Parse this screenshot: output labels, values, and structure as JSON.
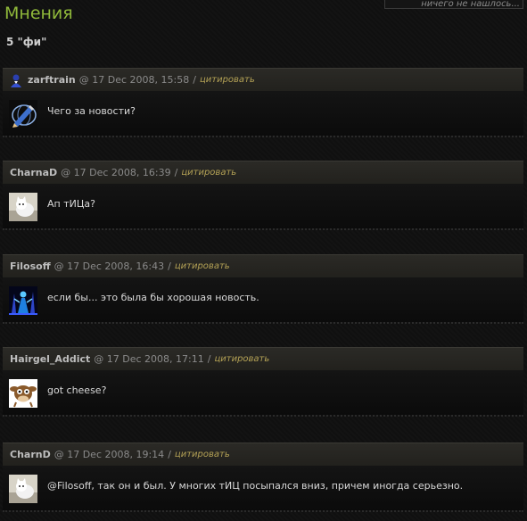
{
  "search": {
    "text": "ничего не нашлось..."
  },
  "page_title": "Мнения",
  "topic_line": "5 \"фи\"",
  "comments": [
    {
      "author": "zarftrain",
      "date": "@ 17 Dec 2008, 15:58",
      "sep": "/",
      "quote": "цитировать",
      "text": "Чего за новости?",
      "avatar_icon": "pencil-globe-icon",
      "header_icon": "user-icon"
    },
    {
      "author": "CharnaD",
      "date": "@ 17 Dec 2008, 16:39",
      "sep": "/",
      "quote": "цитировать",
      "text": "Ап тИЦа?",
      "avatar_icon": "white-cat-icon"
    },
    {
      "author": "Filosoff",
      "date": "@ 17 Dec 2008, 16:43",
      "sep": "/",
      "quote": "цитировать",
      "text": "если бы... это была бы хорошая новость.",
      "avatar_icon": "blue-figure-icon"
    },
    {
      "author": "Hairgel_Addict",
      "date": "@ 17 Dec 2008, 17:11",
      "sep": "/",
      "quote": "цитировать",
      "text": "got cheese?",
      "avatar_icon": "cow-icon"
    },
    {
      "author": "CharnD",
      "date": "@ 17 Dec 2008, 19:14",
      "sep": "/",
      "quote": "цитировать",
      "text": "@Filosoff, так он и был. У многих тИЦ посыпался вниз, причем иногда серьезно.",
      "avatar_icon": "white-cat-icon"
    }
  ]
}
